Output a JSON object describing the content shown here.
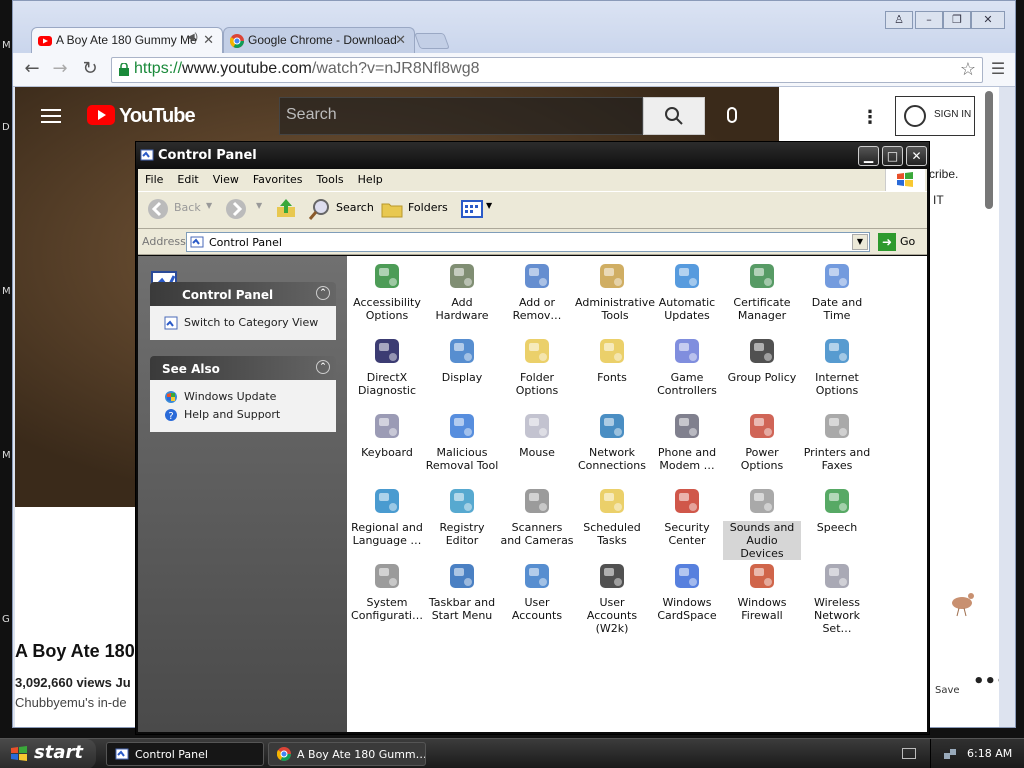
{
  "chrome": {
    "tabs": [
      {
        "title": "A Boy Ate 180 Gummy Me",
        "active": true
      },
      {
        "title": "Google Chrome - Download",
        "active": false
      }
    ],
    "url_scheme": "https://",
    "url_host": "www.youtube.com",
    "url_path": "/watch?v=nJR8Nfl8wg8"
  },
  "youtube": {
    "brand": "YouTube",
    "search_placeholder": "Search",
    "sign_in": "SIGN IN",
    "side_text_1": "cribe.",
    "side_text_2": "IT",
    "video_title": "A Boy Ate 180",
    "views": "3,092,660 views   Ju",
    "description": "Chubbyemu's in-de",
    "save_label": "Save",
    "more_label": "•••"
  },
  "control_panel": {
    "title": "Control Panel",
    "menu": [
      "File",
      "Edit",
      "View",
      "Favorites",
      "Tools",
      "Help"
    ],
    "toolbar": {
      "back": "Back",
      "search": "Search",
      "folders": "Folders"
    },
    "address_label": "Address",
    "address_value": "Control Panel",
    "go_label": "Go",
    "task_panels": {
      "main": {
        "title": "Control Panel",
        "link": "Switch to Category View"
      },
      "see_also": {
        "title": "See Also",
        "links": [
          "Windows Update",
          "Help and Support"
        ]
      }
    },
    "items": [
      {
        "label": "Accessibility Options",
        "icon": "accessibility-icon",
        "color": "#2e8b3a"
      },
      {
        "label": "Add Hardware",
        "icon": "add-hardware-icon",
        "color": "#6a7a5a"
      },
      {
        "label": "Add or Remov…",
        "icon": "add-remove-programs-icon",
        "color": "#4a7ac8"
      },
      {
        "label": "Administrative Tools",
        "icon": "administrative-tools-icon",
        "color": "#c8a048"
      },
      {
        "label": "Automatic Updates",
        "icon": "automatic-updates-icon",
        "color": "#3a8ad8"
      },
      {
        "label": "Certificate Manager",
        "icon": "certificate-manager-icon",
        "color": "#3a8a4a"
      },
      {
        "label": "Date and Time",
        "icon": "date-time-icon",
        "color": "#5a8ad8"
      },
      {
        "label": "DirectX Diagnostic",
        "icon": "directx-icon",
        "color": "#1a1a5a"
      },
      {
        "label": "Display",
        "icon": "display-icon",
        "color": "#3a7ac8"
      },
      {
        "label": "Folder Options",
        "icon": "folder-options-icon",
        "color": "#e8c850"
      },
      {
        "label": "Fonts",
        "icon": "fonts-icon",
        "color": "#e8c850"
      },
      {
        "label": "Game Controllers",
        "icon": "game-controllers-icon",
        "color": "#6a7ad8"
      },
      {
        "label": "Group Policy",
        "icon": "group-policy-icon",
        "color": "#333333"
      },
      {
        "label": "Internet Options",
        "icon": "internet-options-icon",
        "color": "#3a8ac8"
      },
      {
        "label": "Keyboard",
        "icon": "keyboard-icon",
        "color": "#8a8aa8"
      },
      {
        "label": "Malicious Removal Tool",
        "icon": "malicious-removal-icon",
        "color": "#3a7ad8"
      },
      {
        "label": "Mouse",
        "icon": "mouse-icon",
        "color": "#b8b8c8"
      },
      {
        "label": "Network Connections",
        "icon": "network-connections-icon",
        "color": "#2a7ab8"
      },
      {
        "label": "Phone and Modem …",
        "icon": "phone-modem-icon",
        "color": "#6a6a7a"
      },
      {
        "label": "Power Options",
        "icon": "power-options-icon",
        "color": "#c84a3a"
      },
      {
        "label": "Printers and Faxes",
        "icon": "printers-faxes-icon",
        "color": "#9a9a9a"
      },
      {
        "label": "Regional and Language …",
        "icon": "regional-language-icon",
        "color": "#2a8ac8"
      },
      {
        "label": "Registry Editor",
        "icon": "registry-editor-icon",
        "color": "#3a9ac8"
      },
      {
        "label": "Scanners and Cameras",
        "icon": "scanners-cameras-icon",
        "color": "#8a8a8a"
      },
      {
        "label": "Scheduled Tasks",
        "icon": "scheduled-tasks-icon",
        "color": "#e8c850"
      },
      {
        "label": "Security Center",
        "icon": "security-center-icon",
        "color": "#c83a2a"
      },
      {
        "label": "Sounds and Audio Devices",
        "icon": "sounds-audio-icon",
        "color": "#9a9a9a",
        "selected": true
      },
      {
        "label": "Speech",
        "icon": "speech-icon",
        "color": "#3a9a4a"
      },
      {
        "label": "System Configurati…",
        "icon": "system-configuration-icon",
        "color": "#8a8a8a"
      },
      {
        "label": "Taskbar and Start Menu",
        "icon": "taskbar-start-icon",
        "color": "#2a6ab8"
      },
      {
        "label": "User Accounts",
        "icon": "user-accounts-icon",
        "color": "#3a7ac8"
      },
      {
        "label": "User Accounts (W2k)",
        "icon": "user-accounts-w2k-icon",
        "color": "#333333"
      },
      {
        "label": "Windows CardSpace",
        "icon": "cardspace-icon",
        "color": "#3a6ad8"
      },
      {
        "label": "Windows Firewall",
        "icon": "firewall-icon",
        "color": "#c84a2a"
      },
      {
        "label": "Wireless Network Set…",
        "icon": "wireless-network-icon",
        "color": "#9a9aa8"
      }
    ]
  },
  "taskbar": {
    "start": "start",
    "buttons": [
      "Control Panel",
      "A Boy Ate 180 Gumm…"
    ],
    "clock": "6:18 AM"
  },
  "colors": {
    "xp_green": "#2e9a2e",
    "selection_gray": "#d6d6d6",
    "youtube_red": "#ff0000"
  }
}
